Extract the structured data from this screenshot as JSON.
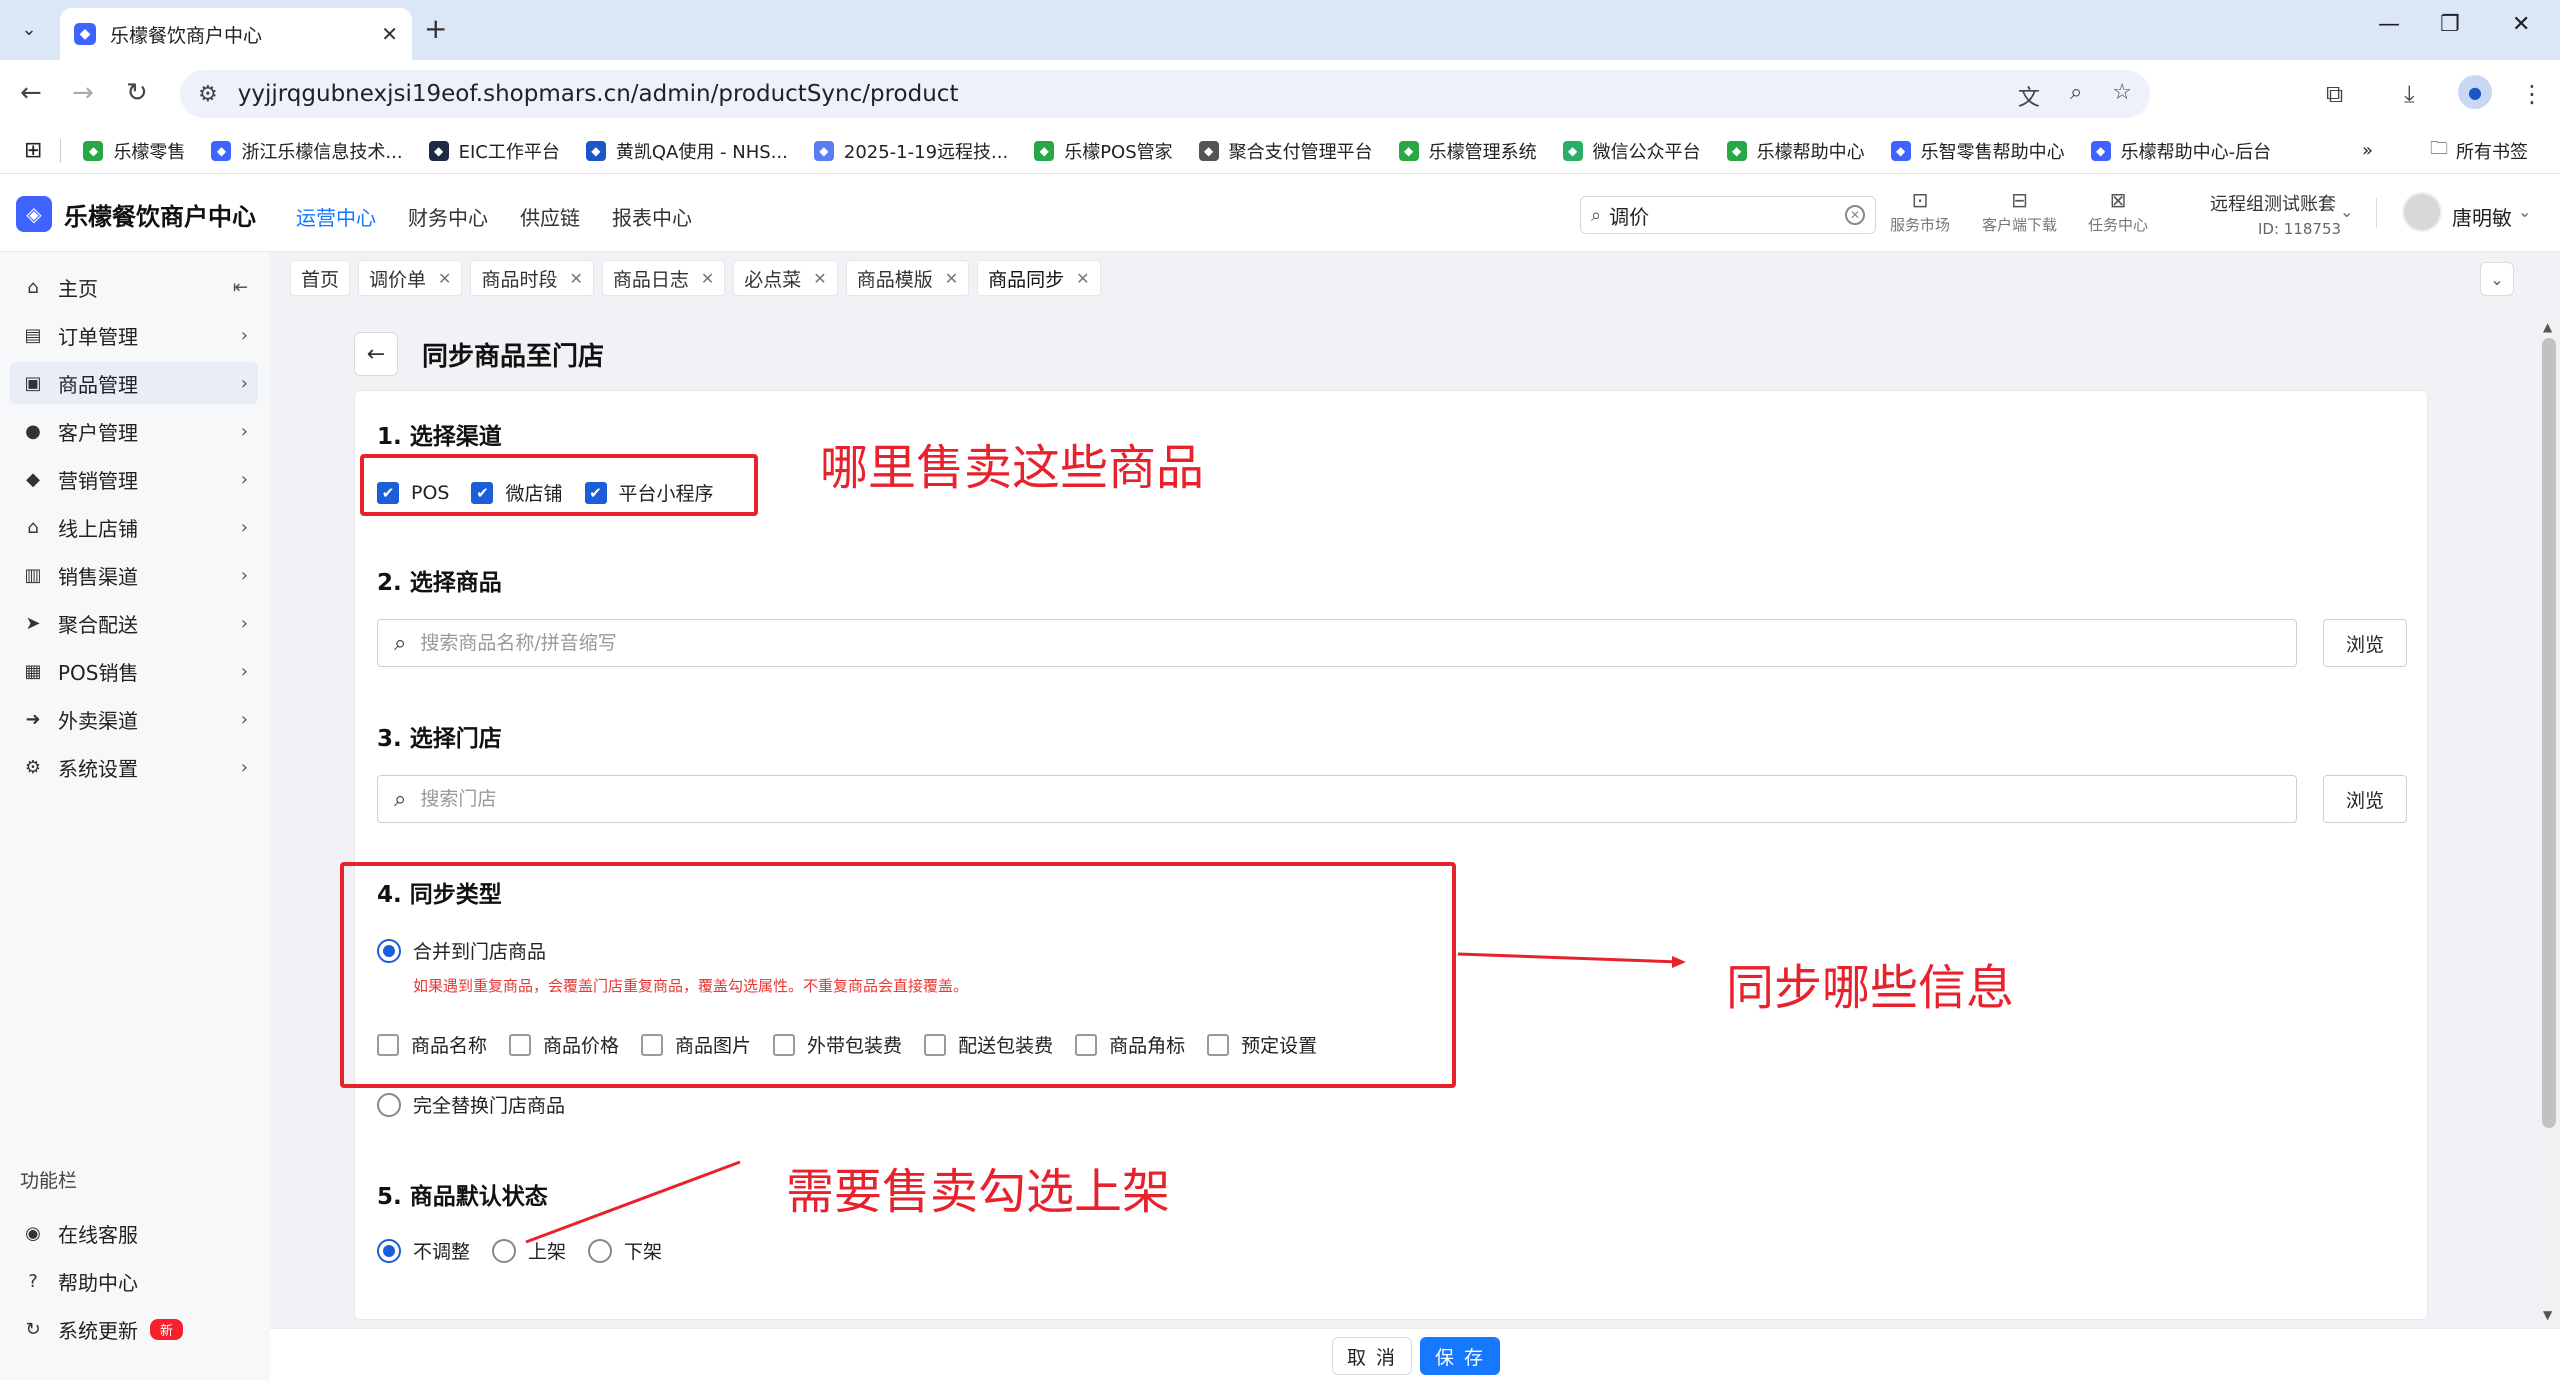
{
  "browser": {
    "tab_title": "乐檬餐饮商户中心",
    "url": "yyjjrqgubnexjsi19eof.shopmars.cn/admin/productSync/product",
    "bookmarks": [
      {
        "label": "乐檬零售",
        "color": "#27a845"
      },
      {
        "label": "浙江乐檬信息技术...",
        "color": "#3f63ff"
      },
      {
        "label": "EIC工作平台",
        "color": "#1f2a44"
      },
      {
        "label": "黄凯QA使用 - NHS...",
        "color": "#1a56c7"
      },
      {
        "label": "2025-1-19远程技...",
        "color": "#5b7cf2"
      },
      {
        "label": "乐檬POS管家",
        "color": "#27a845"
      },
      {
        "label": "聚合支付管理平台",
        "color": "#555555"
      },
      {
        "label": "乐檬管理系统",
        "color": "#27a845"
      },
      {
        "label": "微信公众平台",
        "color": "#2aae67"
      },
      {
        "label": "乐檬帮助中心",
        "color": "#27a845"
      },
      {
        "label": "乐智零售帮助中心",
        "color": "#3f63ff"
      },
      {
        "label": "乐檬帮助中心-后台",
        "color": "#3f63ff"
      }
    ],
    "all_bookmarks": "所有书签"
  },
  "header": {
    "brand": "乐檬餐饮商户中心",
    "nav": [
      "运营中心",
      "财务中心",
      "供应链",
      "报表中心"
    ],
    "search_value": "调价",
    "tools": [
      "服务市场",
      "客户端下载",
      "任务中心"
    ],
    "account_name": "远程组测试账套",
    "account_id": "ID: 118753",
    "user_name": "唐明敏"
  },
  "sidebar": {
    "items": [
      {
        "label": "主页",
        "icon": "home-icon"
      },
      {
        "label": "订单管理",
        "icon": "order-icon"
      },
      {
        "label": "商品管理",
        "icon": "product-icon"
      },
      {
        "label": "客户管理",
        "icon": "customer-icon"
      },
      {
        "label": "营销管理",
        "icon": "tag-icon"
      },
      {
        "label": "线上店铺",
        "icon": "store-icon"
      },
      {
        "label": "销售渠道",
        "icon": "bank-icon"
      },
      {
        "label": "聚合配送",
        "icon": "delivery-icon"
      },
      {
        "label": "POS销售",
        "icon": "pos-icon"
      },
      {
        "label": "外卖渠道",
        "icon": "takeout-icon"
      },
      {
        "label": "系统设置",
        "icon": "gear-icon"
      }
    ],
    "section_label": "功能栏",
    "tools": [
      {
        "label": "在线客服",
        "icon": "headset-icon"
      },
      {
        "label": "帮助中心",
        "icon": "help-icon"
      },
      {
        "label": "系统更新",
        "icon": "refresh-icon",
        "badge": "新"
      }
    ]
  },
  "page_tabs": [
    "首页",
    "调价单",
    "商品时段",
    "商品日志",
    "必点菜",
    "商品模版",
    "商品同步"
  ],
  "page": {
    "title": "同步商品至门店",
    "sections": {
      "channel_title": "1. 选择渠道",
      "channels": [
        {
          "label": "POS",
          "checked": true
        },
        {
          "label": "微店铺",
          "checked": true
        },
        {
          "label": "平台小程序",
          "checked": true
        }
      ],
      "product_title": "2. 选择商品",
      "product_placeholder": "搜索商品名称/拼音缩写",
      "store_title": "3. 选择门店",
      "store_placeholder": "搜索门店",
      "browse_label": "浏览",
      "sync_title": "4. 同步类型",
      "sync_merge": "合并到门店商品",
      "sync_hint": "如果遇到重复商品，会覆盖门店重复商品，覆盖勾选属性。不重复商品会直接覆盖。",
      "sync_fields": [
        "商品名称",
        "商品价格",
        "商品图片",
        "外带包装费",
        "配送包装费",
        "商品角标",
        "预定设置"
      ],
      "sync_replace": "完全替换门店商品",
      "status_title": "5. 商品默认状态",
      "status_options": [
        {
          "label": "不调整",
          "selected": true
        },
        {
          "label": "上架",
          "selected": false
        },
        {
          "label": "下架",
          "selected": false
        }
      ]
    }
  },
  "footer": {
    "cancel": "取 消",
    "save": "保 存"
  },
  "annotations": {
    "note_channel": "哪里售卖这些商品",
    "note_sync": "同步哪些信息",
    "note_status": "需要售卖勾选上架",
    "color": "#e8222d"
  },
  "colors": {
    "accent": "#1677ff",
    "checkbox": "#1a5fd9",
    "hint": "#e53935"
  }
}
